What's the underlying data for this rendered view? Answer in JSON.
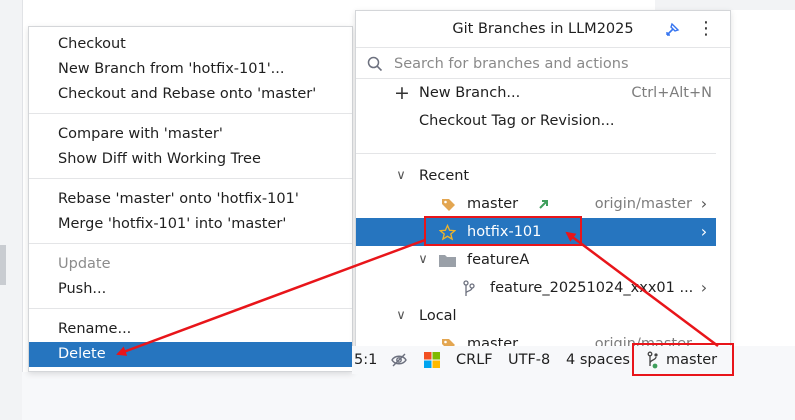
{
  "context_menu": {
    "items": [
      {
        "label": "Checkout",
        "state": "normal"
      },
      {
        "label": "New Branch from 'hotfix-101'...",
        "state": "normal"
      },
      {
        "label": "Checkout and Rebase onto 'master'",
        "state": "normal"
      },
      {
        "label": "Compare with 'master'",
        "state": "normal"
      },
      {
        "label": "Show Diff with Working Tree",
        "state": "normal"
      },
      {
        "label": "Rebase 'master' onto 'hotfix-101'",
        "state": "normal"
      },
      {
        "label": "Merge 'hotfix-101' into 'master'",
        "state": "normal"
      },
      {
        "label": "Update",
        "state": "disabled"
      },
      {
        "label": "Push...",
        "state": "normal"
      },
      {
        "label": "Rename...",
        "state": "normal"
      },
      {
        "label": "Delete",
        "state": "selected"
      }
    ]
  },
  "branches_popup": {
    "title": "Git Branches in LLM2025",
    "search_placeholder": "Search for branches and actions",
    "actions": [
      {
        "label": "New Branch...",
        "shortcut": "Ctrl+Alt+N"
      },
      {
        "label": "Checkout Tag or Revision..."
      }
    ],
    "recent": {
      "label": "Recent",
      "branches": [
        {
          "name": "master",
          "remote": "origin/master",
          "icon": "tag-icon"
        },
        {
          "name": "hotfix-101",
          "icon": "star-icon",
          "selected": true
        }
      ],
      "folder": {
        "name": "featureA",
        "branches": [
          {
            "name": "feature_20251024_xxx01 ..."
          }
        ]
      }
    },
    "local": {
      "label": "Local",
      "branches": [
        {
          "name": "master",
          "remote": "origin/master"
        }
      ]
    }
  },
  "status_bar": {
    "position": "5:1",
    "line_separator": "CRLF",
    "encoding": "UTF-8",
    "indent": "4 spaces",
    "branch": "master"
  },
  "colors": {
    "selection": "#2675bf",
    "annotation_red": "#e8151a",
    "tag_orange": "#e3a651",
    "incoming_green": "#3e9e5b"
  }
}
